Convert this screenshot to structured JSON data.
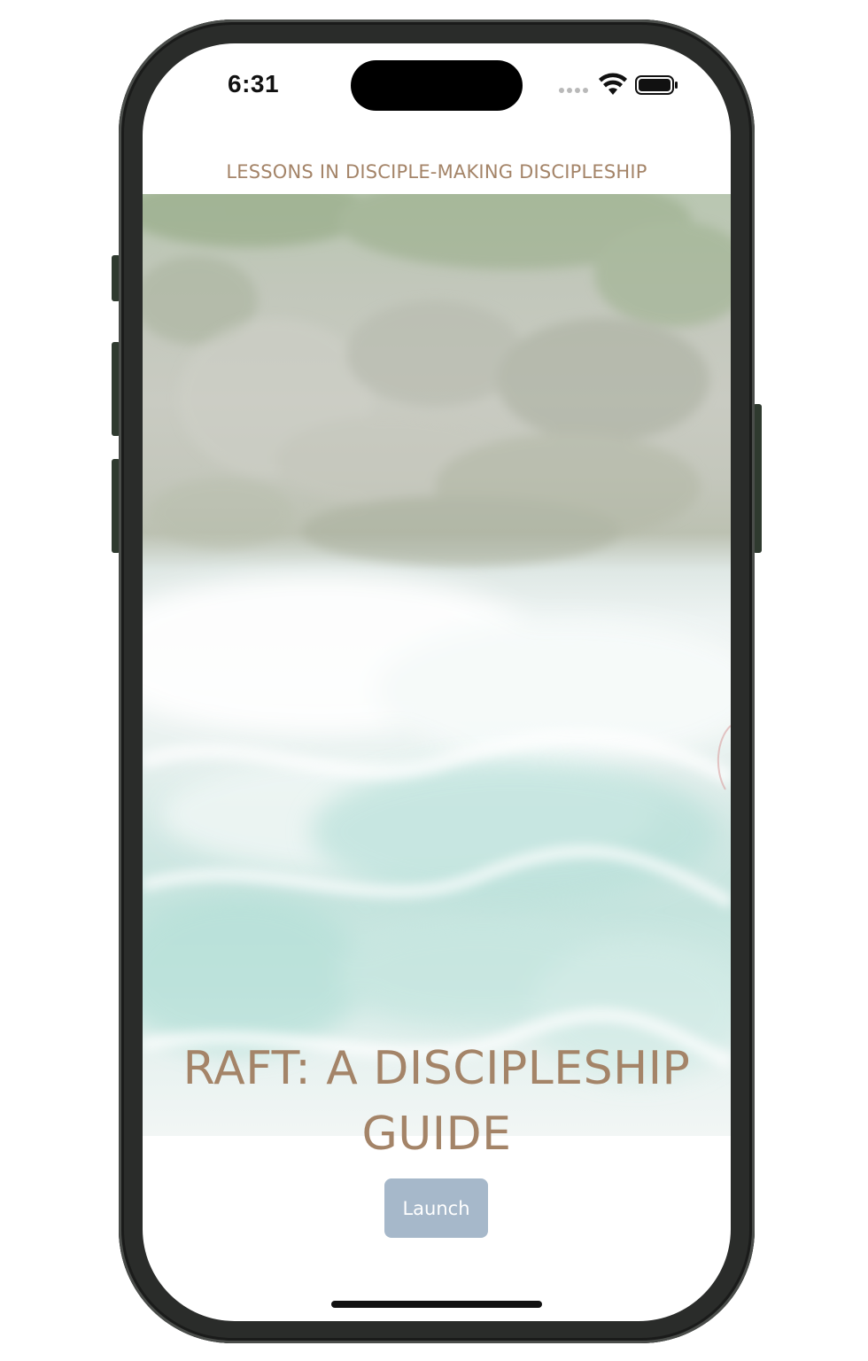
{
  "status_bar": {
    "time": "6:31",
    "icons": [
      "signal-dots-icon",
      "wifi-icon",
      "battery-icon"
    ]
  },
  "header": {
    "subtitle": "LESSONS IN DISCIPLE-MAKING DISCIPLESHIP"
  },
  "hero": {
    "image": "river-rapids-aerial-photo",
    "title_line1": "RAFT: A DISCIPLESHIP",
    "title_line2": "GUIDE"
  },
  "actions": {
    "launch_label": "Launch"
  },
  "colors": {
    "accent_text": "#a48468",
    "button_bg": "#a6b8ca",
    "button_text": "#ffffff",
    "frame": "#2a2c2a"
  }
}
